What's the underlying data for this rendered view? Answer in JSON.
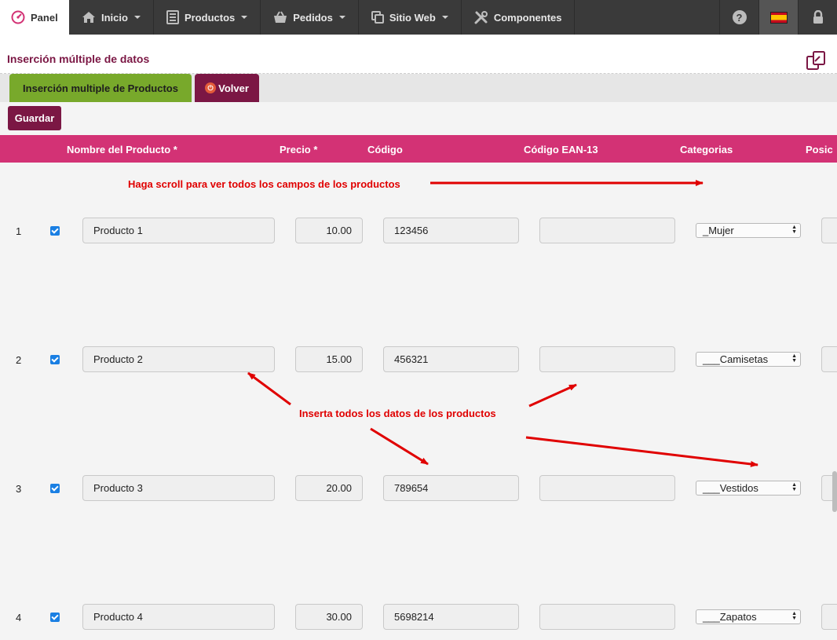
{
  "nav": {
    "panel": "Panel",
    "inicio": "Inicio",
    "productos": "Productos",
    "pedidos": "Pedidos",
    "sitio_web": "Sitio Web",
    "componentes": "Componentes",
    "help": "?"
  },
  "page": {
    "title": "Inserción múltiple de datos"
  },
  "tabs": {
    "insert_label": "Inserción multiple de Productos",
    "back_label": "Volver"
  },
  "toolbar": {
    "save_label": "Guardar"
  },
  "columns": {
    "name": "Nombre del Producto *",
    "price": "Precio *",
    "code": "Código",
    "ean": "Código EAN-13",
    "categories": "Categorias",
    "position": "Posic"
  },
  "rows": [
    {
      "num": "1",
      "checked": true,
      "name": "Producto 1",
      "price": "10.00",
      "code": "123456",
      "ean": "",
      "category": "_Mujer"
    },
    {
      "num": "2",
      "checked": true,
      "name": "Producto 2",
      "price": "15.00",
      "code": "456321",
      "ean": "",
      "category": "___Camisetas"
    },
    {
      "num": "3",
      "checked": true,
      "name": "Producto 3",
      "price": "20.00",
      "code": "789654",
      "ean": "",
      "category": "___Vestidos"
    },
    {
      "num": "4",
      "checked": true,
      "name": "Producto 4",
      "price": "30.00",
      "code": "5698214",
      "ean": "",
      "category": "___Zapatos"
    }
  ],
  "annotations": {
    "scroll_hint": "Haga scroll para ver todos los campos de los productos",
    "insert_hint": "Inserta todos los datos de los productos"
  },
  "colors": {
    "brand": "#7b1744",
    "header_pink": "#d33275",
    "tab_green": "#78a92b",
    "annotation_red": "#e00000"
  },
  "icons": [
    "dashboard-icon",
    "home-icon",
    "products-icon",
    "basket-icon",
    "copy-icon",
    "tools-icon",
    "help-icon",
    "spain-flag-icon",
    "lock-icon",
    "power-icon"
  ]
}
